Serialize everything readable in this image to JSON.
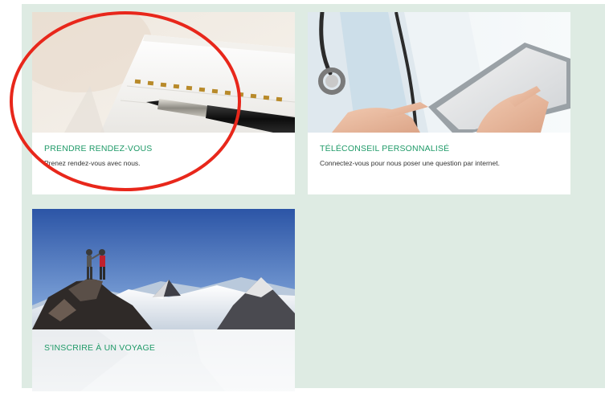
{
  "cards": [
    {
      "title": "PRENDRE RENDEZ-VOUS",
      "description": "Prenez rendez-vous avec nous."
    },
    {
      "title": "TÉLÉCONSEIL PERSONNALISÉ",
      "description": "Connectez-vous pour nous poser une question par internet."
    },
    {
      "title": "S'INSCRIRE À UN VOYAGE",
      "description": ""
    }
  ],
  "colors": {
    "panel_background": "#deebe3",
    "title_green": "#1f9a68",
    "annotation_red": "#e8271b"
  }
}
